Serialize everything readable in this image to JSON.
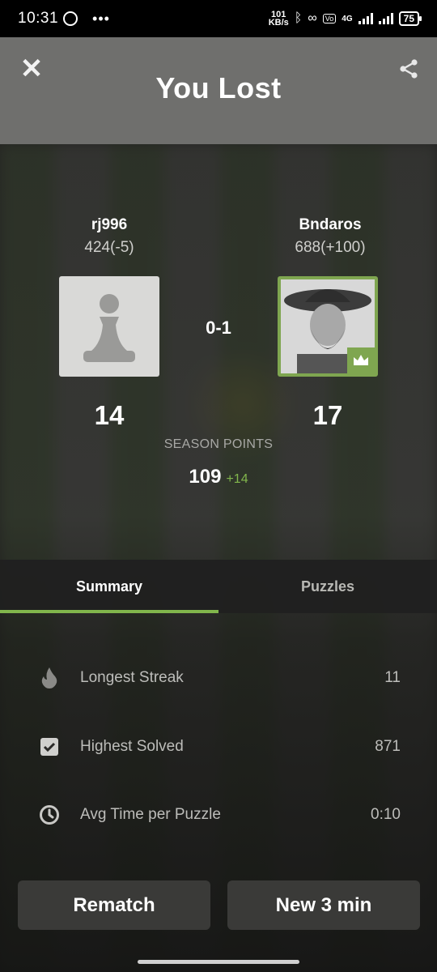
{
  "status_bar": {
    "time": "10:31",
    "net_speed_value": "101",
    "net_speed_unit": "KB/s",
    "network_type": "4G",
    "battery": "75"
  },
  "header": {
    "title": "You Lost"
  },
  "players": {
    "left": {
      "name": "rj996",
      "rating": "424(-5)",
      "points": "14"
    },
    "right": {
      "name": "Bndaros",
      "rating": "688(+100)",
      "points": "17"
    }
  },
  "score": "0-1",
  "season": {
    "label": "SEASON POINTS",
    "value": "109",
    "delta": "+14"
  },
  "tabs": [
    {
      "label": "Summary",
      "active": true
    },
    {
      "label": "Puzzles",
      "active": false
    }
  ],
  "stats": [
    {
      "icon": "flame-icon",
      "label": "Longest Streak",
      "value": "11"
    },
    {
      "icon": "checkbox-icon",
      "label": "Highest Solved",
      "value": "871"
    },
    {
      "icon": "clock-icon",
      "label": "Avg Time per Puzzle",
      "value": "0:10"
    }
  ],
  "buttons": {
    "rematch": "Rematch",
    "new_game": "New 3 min"
  },
  "colors": {
    "accent": "#81b64c",
    "header_bg": "#6f6f6d",
    "button_bg": "#3a3a38"
  }
}
